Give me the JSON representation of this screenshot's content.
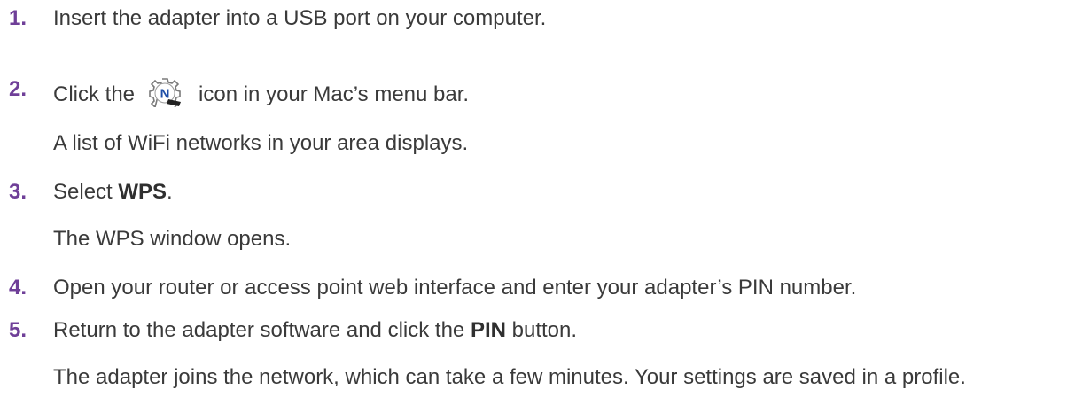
{
  "steps": [
    {
      "number": "1.",
      "text": "Insert the adapter into a USB port on your computer."
    },
    {
      "number": "2.",
      "before_icon": "Click the",
      "icon": "netgear-n-gear-icon",
      "after_icon": "icon in your Mac’s menu bar.",
      "result": "A list of WiFi networks in your area displays."
    },
    {
      "number": "3.",
      "prefix": "Select",
      "bold": "WPS",
      "suffix": ".",
      "result": "The WPS window opens."
    },
    {
      "number": "4.",
      "text": "Open your router or access point web interface and enter your adapter’s PIN number."
    },
    {
      "number": "5.",
      "prefix": "Return to the adapter software and click the",
      "bold": "PIN",
      "suffix": "button.",
      "result": "The adapter joins the network, which can take a few minutes. Your settings are saved in a profile."
    }
  ],
  "colors": {
    "step_number": "#6f3f98",
    "body_text": "#3a3a3a",
    "icon_blue": "#1f4fa8"
  }
}
